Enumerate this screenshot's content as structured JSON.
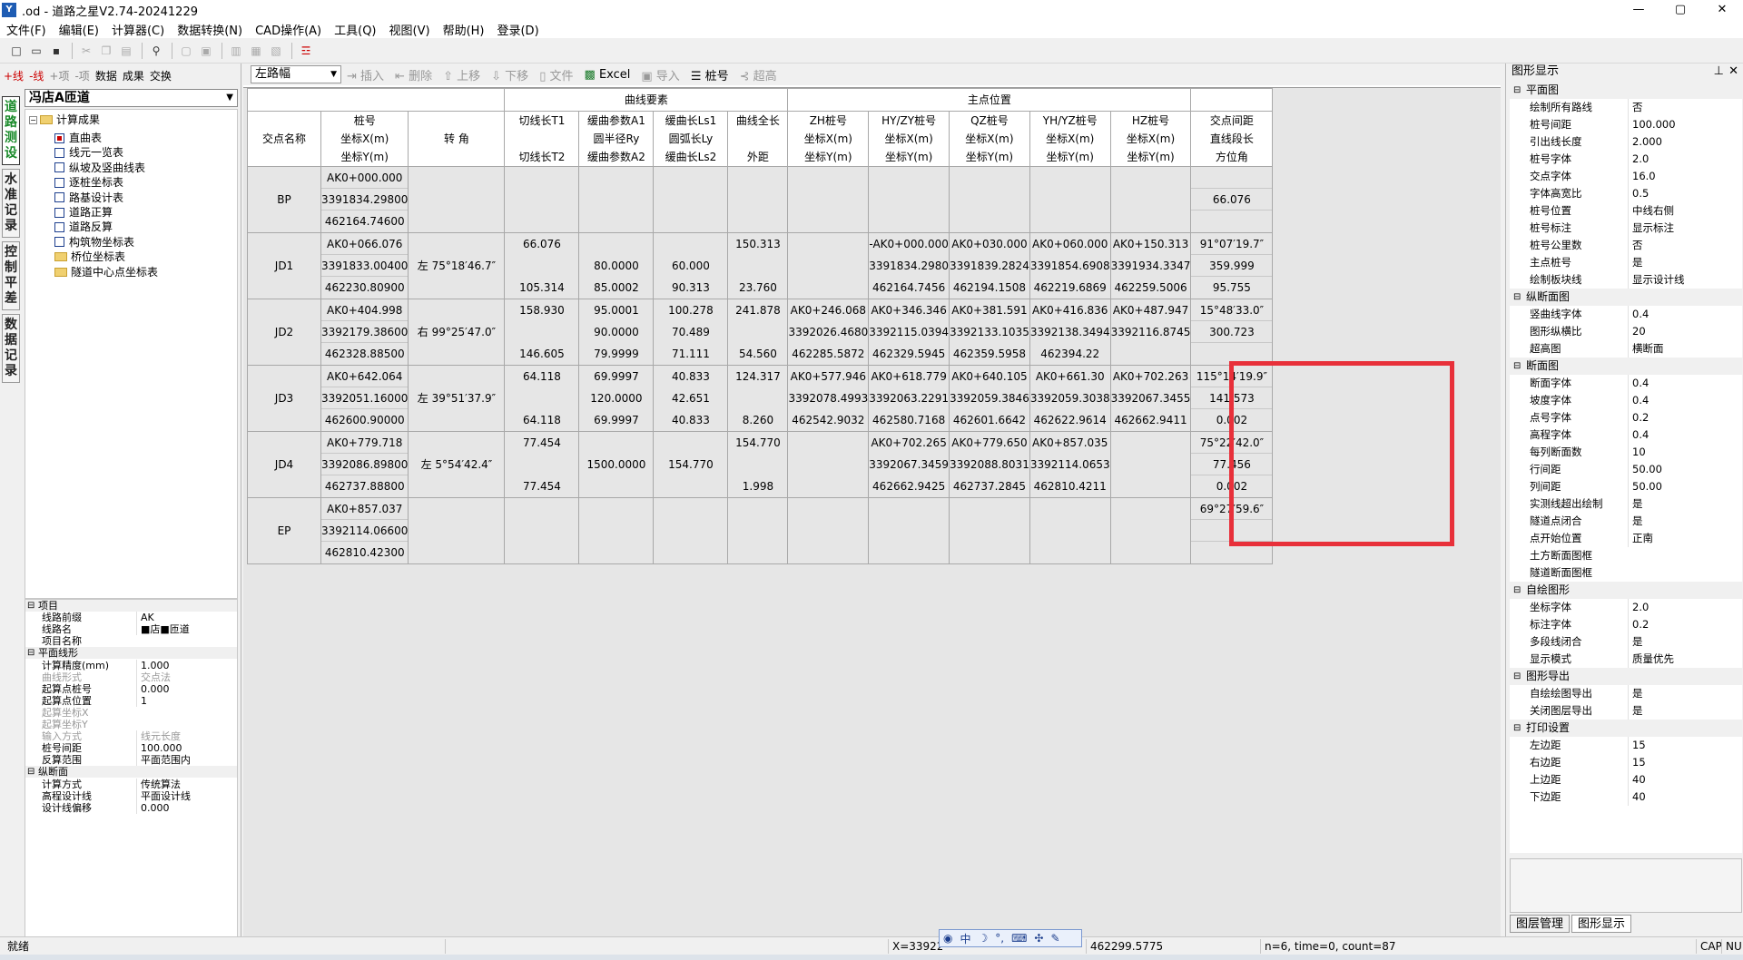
{
  "window": {
    "title": "道路之星V2.74-20241229",
    "title_prefix": ".od - ",
    "min": "—",
    "max": "▢",
    "close": "✕"
  },
  "menu": [
    "文件(F)",
    "编辑(E)",
    "计算器(C)",
    "数据转换(N)",
    "CAD操作(A)",
    "工具(Q)",
    "视图(V)",
    "帮助(H)",
    "登录(D)"
  ],
  "left_toolbar": {
    "add_line": "+线",
    "del_line": "-线",
    "add_item": "+项",
    "del_item": "-项",
    "data": "数据",
    "result": "成果",
    "swap": "交换"
  },
  "vertical_tabs": [
    "道路测设",
    "水准记录",
    "控制平差",
    "数据记录"
  ],
  "route_select": "冯店A匝道",
  "tree": {
    "root": "计算成果",
    "items": [
      {
        "label": "直曲表",
        "type": "checkbox",
        "checked": true
      },
      {
        "label": "线元一览表",
        "type": "checkbox"
      },
      {
        "label": "纵坡及竖曲线表",
        "type": "checkbox"
      },
      {
        "label": "逐桩坐标表",
        "type": "checkbox"
      },
      {
        "label": "路基设计表",
        "type": "checkbox"
      },
      {
        "label": "道路正算",
        "type": "checkbox"
      },
      {
        "label": "道路反算",
        "type": "checkbox"
      },
      {
        "label": "构筑物坐标表",
        "type": "checkbox"
      },
      {
        "label": "桥位坐标表",
        "type": "folder"
      },
      {
        "label": "隧道中心点坐标表",
        "type": "folder"
      }
    ]
  },
  "left_props": [
    {
      "cat": true,
      "k": "项目"
    },
    {
      "k": "线路前缀",
      "v": "AK"
    },
    {
      "k": "线路名",
      "v": "■店■匝道"
    },
    {
      "k": "项目名称",
      "v": ""
    },
    {
      "cat": true,
      "k": "平面线形"
    },
    {
      "k": "计算精度(mm)",
      "v": "1.000"
    },
    {
      "k": "曲线形式",
      "v": "交点法",
      "dim": true
    },
    {
      "k": "起算点桩号",
      "v": "0.000"
    },
    {
      "k": "起算点位置",
      "v": "1"
    },
    {
      "k": "起算坐标X",
      "v": "",
      "dim": true
    },
    {
      "k": "起算坐标Y",
      "v": "",
      "dim": true
    },
    {
      "k": "输入方式",
      "v": "线元长度",
      "dim": true
    },
    {
      "k": "桩号间距",
      "v": "100.000"
    },
    {
      "k": "反算范围",
      "v": "平面范围内"
    },
    {
      "cat": true,
      "k": "纵断面"
    },
    {
      "k": "计算方式",
      "v": "传统算法"
    },
    {
      "k": "高程设计线",
      "v": "平面设计线"
    },
    {
      "k": "设计线偏移",
      "v": "0.000"
    }
  ],
  "main_toolbar": {
    "side": "左路幅",
    "insert": "插入",
    "delete": "删除",
    "up": "上移",
    "down": "下移",
    "file": "文件",
    "excel": "Excel",
    "import": "导入",
    "stake": "桩号",
    "superelev": "超高"
  },
  "table": {
    "group_headers": {
      "curve": "曲线要素",
      "main": "主点位置"
    },
    "col_headers": [
      [
        "交点名称"
      ],
      [
        "桩号",
        "坐标X(m)",
        "坐标Y(m)"
      ],
      [
        "转 角"
      ],
      [
        "切线长T1",
        "",
        "切线长T2"
      ],
      [
        "缓曲参数A1",
        "圆半径Ry",
        "缓曲参数A2"
      ],
      [
        "缓曲长Ls1",
        "圆弧长Ly",
        "缓曲长Ls2"
      ],
      [
        "曲线全长",
        "",
        "外距"
      ],
      [
        "ZH桩号",
        "坐标X(m)",
        "坐标Y(m)"
      ],
      [
        "HY/ZY桩号",
        "坐标X(m)",
        "坐标Y(m)"
      ],
      [
        "QZ桩号",
        "坐标X(m)",
        "坐标Y(m)"
      ],
      [
        "YH/YZ桩号",
        "坐标X(m)",
        "坐标Y(m)"
      ],
      [
        "HZ桩号",
        "坐标X(m)",
        "坐标Y(m)"
      ],
      [
        "交点间距",
        "直线段长",
        "方位角"
      ]
    ],
    "rows": [
      {
        "name": "BP",
        "pk": [
          "AK0+000.000",
          "3391834.29800",
          "462164.74600"
        ],
        "angle": "",
        "t": [
          "",
          "",
          ""
        ],
        "a": [
          "",
          "",
          ""
        ],
        "ls": [
          "",
          "",
          ""
        ],
        "len": [
          "",
          "",
          ""
        ],
        "zh": [
          "",
          "",
          ""
        ],
        "hy": [
          "",
          "",
          ""
        ],
        "qz": [
          "",
          "",
          ""
        ],
        "yh": [
          "",
          "",
          ""
        ],
        "hz": [
          "",
          "",
          ""
        ],
        "dist": [
          "",
          "66.076",
          ""
        ]
      },
      {
        "name": "JD1",
        "pk": [
          "AK0+066.076",
          "3391833.00400",
          "462230.80900"
        ],
        "angle": "左 75°18′46.7″",
        "t": [
          "66.076",
          "",
          "105.314"
        ],
        "a": [
          "",
          "80.0000",
          "85.0002"
        ],
        "ls": [
          "",
          "60.000",
          "90.313"
        ],
        "len": [
          "150.313",
          "",
          "23.760"
        ],
        "zh": [
          "",
          "",
          ""
        ],
        "hy": [
          "-AK0+000.000",
          "3391834.2980",
          "462164.7456"
        ],
        "qz": [
          "AK0+030.000",
          "3391839.2824",
          "462194.1508"
        ],
        "yh": [
          "AK0+060.000",
          "3391854.6908",
          "462219.6869"
        ],
        "hz": [
          "AK0+150.313",
          "3391934.3347",
          "462259.5006"
        ],
        "dist": [
          "91°07′19.7″",
          "359.999",
          "95.755"
        ]
      },
      {
        "name": "JD2",
        "pk": [
          "AK0+404.998",
          "3392179.38600",
          "462328.88500"
        ],
        "angle": "右 99°25′47.0″",
        "t": [
          "158.930",
          "",
          "146.605"
        ],
        "a": [
          "95.0001",
          "90.0000",
          "79.9999"
        ],
        "ls": [
          "100.278",
          "70.489",
          "71.111"
        ],
        "len": [
          "241.878",
          "",
          "54.560"
        ],
        "zh": [
          "AK0+246.068",
          "3392026.4680",
          "462285.5872"
        ],
        "hy": [
          "AK0+346.346",
          "3392115.0394",
          "462329.5945"
        ],
        "qz": [
          "AK0+381.591",
          "3392133.1035",
          "462359.5958"
        ],
        "yh": [
          "AK0+416.836",
          "3392138.3494",
          "462394.22"
        ],
        "hz": [
          "AK0+487.947",
          "3392116.8745",
          ""
        ],
        "dist": [
          "15°48′33.0″",
          "300.723",
          ""
        ]
      },
      {
        "name": "JD3",
        "pk": [
          "AK0+642.064",
          "3392051.16000",
          "462600.90000"
        ],
        "angle": "左 39°51′37.9″",
        "t": [
          "64.118",
          "",
          "64.118"
        ],
        "a": [
          "69.9997",
          "120.0000",
          "69.9997"
        ],
        "ls": [
          "40.833",
          "42.651",
          "40.833"
        ],
        "len": [
          "124.317",
          "",
          "8.260"
        ],
        "zh": [
          "AK0+577.946",
          "3392078.4993",
          "462542.9032"
        ],
        "hy": [
          "AK0+618.779",
          "3392063.2291",
          "462580.7168"
        ],
        "qz": [
          "AK0+640.105",
          "3392059.3846",
          "462601.6642"
        ],
        "yh": [
          "AK0+661.30",
          "3392059.3038",
          "462622.9614"
        ],
        "hz": [
          "AK0+702.263",
          "3392067.3455",
          "462662.9411"
        ],
        "dist": [
          "115°14′19.9″",
          "141.573",
          "0.002"
        ]
      },
      {
        "name": "JD4",
        "pk": [
          "AK0+779.718",
          "3392086.89800",
          "462737.88800"
        ],
        "angle": "左 5°54′42.4″",
        "t": [
          "77.454",
          "",
          "77.454"
        ],
        "a": [
          "",
          "1500.0000",
          ""
        ],
        "ls": [
          "",
          "154.770",
          ""
        ],
        "len": [
          "154.770",
          "",
          "1.998"
        ],
        "zh": [
          "",
          "",
          ""
        ],
        "hy": [
          "AK0+702.265",
          "3392067.3459",
          "462662.9425"
        ],
        "qz": [
          "AK0+779.650",
          "3392088.8031",
          "462737.2845"
        ],
        "yh": [
          "AK0+857.035",
          "3392114.0653",
          "462810.4211"
        ],
        "hz": [
          "",
          "",
          ""
        ],
        "dist": [
          "75°22′42.0″",
          "77.456",
          "0.002"
        ]
      },
      {
        "name": "EP",
        "pk": [
          "AK0+857.037",
          "3392114.06600",
          "462810.42300"
        ],
        "angle": "",
        "t": [
          "",
          "",
          ""
        ],
        "a": [
          "",
          "",
          ""
        ],
        "ls": [
          "",
          "",
          ""
        ],
        "len": [
          "",
          "",
          ""
        ],
        "zh": [
          "",
          "",
          ""
        ],
        "hy": [
          "",
          "",
          ""
        ],
        "qz": [
          "",
          "",
          ""
        ],
        "yh": [
          "",
          "",
          ""
        ],
        "hz": [
          "",
          "",
          ""
        ],
        "dist": [
          "69°27′59.6″",
          "",
          ""
        ]
      }
    ]
  },
  "right_panel": {
    "title": "图形显示",
    "props": [
      {
        "cat": true,
        "k": "平面图"
      },
      {
        "k": "绘制所有路线",
        "v": "否"
      },
      {
        "k": "桩号间距",
        "v": "100.000"
      },
      {
        "k": "引出线长度",
        "v": "2.000"
      },
      {
        "k": "桩号字体",
        "v": "2.0"
      },
      {
        "k": "交点字体",
        "v": "16.0"
      },
      {
        "k": "字体高宽比",
        "v": "0.5"
      },
      {
        "k": "桩号位置",
        "v": "中线右侧"
      },
      {
        "k": "桩号标注",
        "v": "显示标注"
      },
      {
        "k": "桩号公里数",
        "v": "否"
      },
      {
        "k": "主点桩号",
        "v": "是"
      },
      {
        "k": "绘制板块线",
        "v": "显示设计线"
      },
      {
        "cat": true,
        "k": "纵断面图"
      },
      {
        "k": "竖曲线字体",
        "v": "0.4"
      },
      {
        "k": "图形纵横比",
        "v": "20"
      },
      {
        "k": "超高图",
        "v": "横断面"
      },
      {
        "cat": true,
        "k": "断面图"
      },
      {
        "k": "断面字体",
        "v": "0.4"
      },
      {
        "k": "坡度字体",
        "v": "0.4"
      },
      {
        "k": "点号字体",
        "v": "0.2"
      },
      {
        "k": "高程字体",
        "v": "0.4"
      },
      {
        "k": "每列断面数",
        "v": "10"
      },
      {
        "k": "行间距",
        "v": "50.00"
      },
      {
        "k": "列间距",
        "v": "50.00"
      },
      {
        "k": "实测线超出绘制",
        "v": "是"
      },
      {
        "k": "隧道点闭合",
        "v": "是"
      },
      {
        "k": "点开始位置",
        "v": "正南"
      },
      {
        "k": "土方断面图框",
        "v": ""
      },
      {
        "k": "隧道断面图框",
        "v": ""
      },
      {
        "cat": true,
        "k": "自绘图形"
      },
      {
        "k": "坐标字体",
        "v": "2.0"
      },
      {
        "k": "标注字体",
        "v": "0.2"
      },
      {
        "k": "多段线闭合",
        "v": "是"
      },
      {
        "k": "显示模式",
        "v": "质量优先"
      },
      {
        "cat": true,
        "k": "图形导出"
      },
      {
        "k": "自绘绘图导出",
        "v": "是"
      },
      {
        "k": "关闭图层导出",
        "v": "是"
      },
      {
        "cat": true,
        "k": "打印设置"
      },
      {
        "k": "左边距",
        "v": "15"
      },
      {
        "k": "右边距",
        "v": "15"
      },
      {
        "k": "上边距",
        "v": "40"
      },
      {
        "k": "下边距",
        "v": "40"
      }
    ],
    "tabs": [
      "图层管理",
      "图形显示"
    ]
  },
  "status": {
    "ready": "就绪",
    "coord_x": "X=339222",
    "coord_y": "462299.5775",
    "info": "n=6, time=0, count=87",
    "cap": "CAP",
    "num": "NU"
  },
  "ime": [
    "中",
    "☽",
    "°,",
    "⌨",
    "✣",
    "✎"
  ]
}
